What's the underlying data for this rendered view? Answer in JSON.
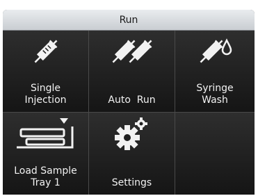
{
  "window": {
    "title": "Run"
  },
  "tiles": [
    {
      "label": "Single\nInjection",
      "icon": "syringe-icon"
    },
    {
      "label": "Auto  Run",
      "icon": "double-syringe-icon"
    },
    {
      "label": "Syringe\nWash",
      "icon": "syringe-drop-icon"
    },
    {
      "label": "Load  Sample\nTray  1",
      "icon": "tray-eject-icon"
    },
    {
      "label": "Settings",
      "icon": "gears-icon"
    }
  ],
  "colors": {
    "tile_bg": "#1e1e1e",
    "title_bg": "#d8dbdf",
    "text": "#f2f2f2"
  }
}
